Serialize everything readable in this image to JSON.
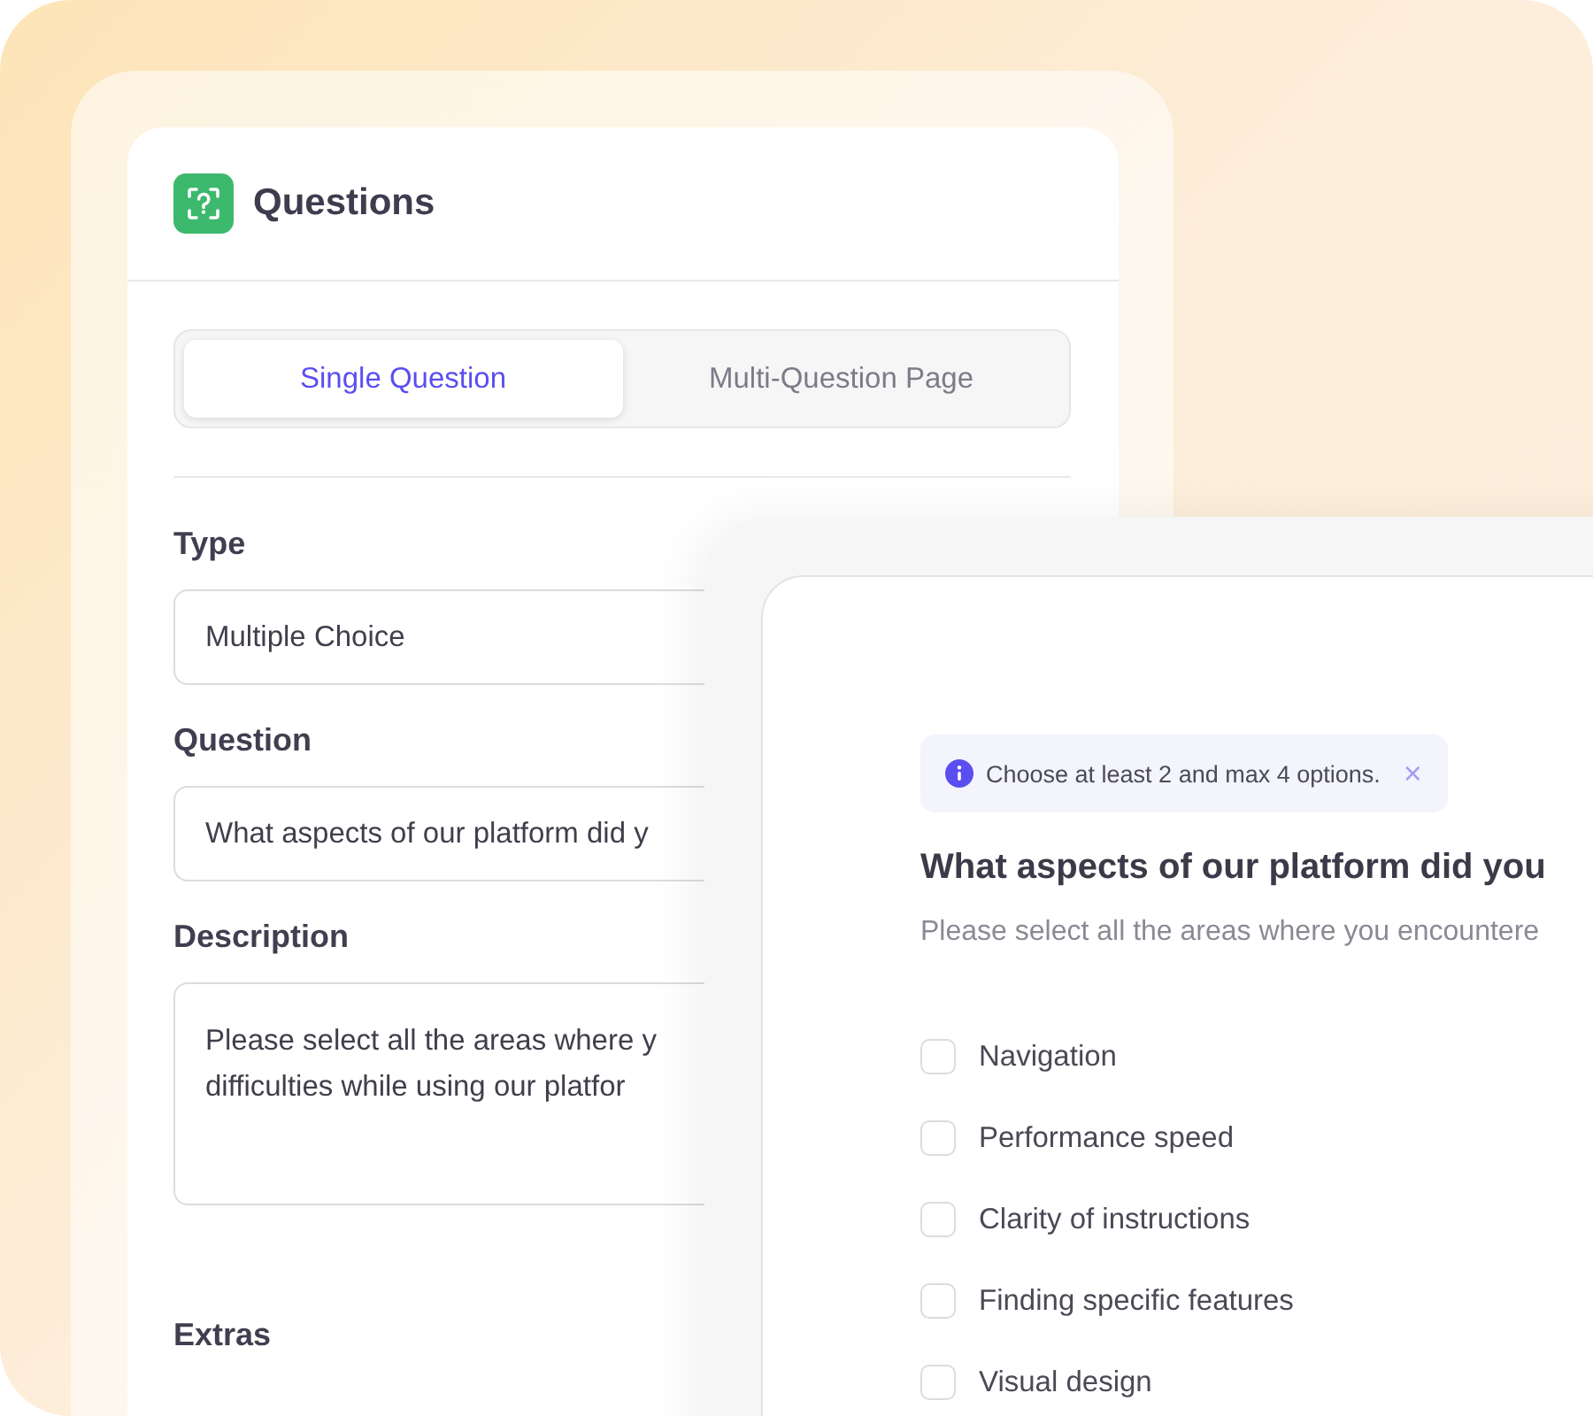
{
  "editor": {
    "title": "Questions",
    "tabs": [
      {
        "label": "Single Question",
        "selected": true
      },
      {
        "label": "Multi-Question Page",
        "selected": false
      }
    ],
    "fields": [
      {
        "label": "Type",
        "value": "Multiple Choice",
        "kind": "input"
      },
      {
        "label": "Question",
        "value": "What aspects of our platform did y",
        "kind": "input"
      },
      {
        "label": "Description",
        "value": "Please select all the areas where y\ndifficulties while using our platfor",
        "kind": "textarea"
      }
    ],
    "extras_label": "Extras"
  },
  "preview": {
    "notice": {
      "text": "Choose at least 2 and max 4 options.",
      "close": "×"
    },
    "question": "What aspects of our platform did you",
    "description": "Please select all the areas where you encountere",
    "options": [
      {
        "label": "Navigation",
        "checked": false
      },
      {
        "label": "Performance speed",
        "checked": false
      },
      {
        "label": "Clarity of instructions",
        "checked": false
      },
      {
        "label": "Finding specific features",
        "checked": false
      },
      {
        "label": "Visual design",
        "checked": false
      }
    ]
  }
}
